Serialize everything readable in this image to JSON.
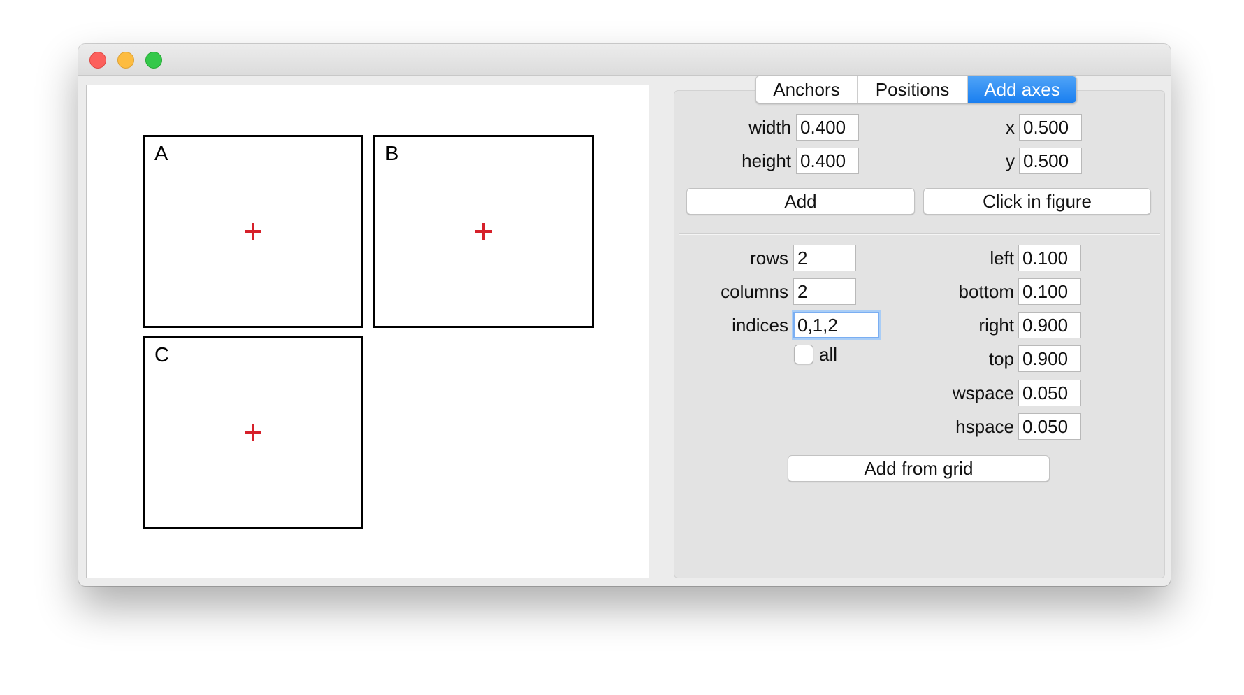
{
  "window": {
    "controls": {
      "close": "close-button",
      "minimize": "minimize-button",
      "zoom": "zoom-button"
    }
  },
  "figure": {
    "axes": [
      {
        "label": "A",
        "marker": "red-cross-icon"
      },
      {
        "label": "B",
        "marker": "red-cross-icon"
      },
      {
        "label": "C",
        "marker": "red-cross-icon"
      }
    ],
    "marker_color": "#d6202a"
  },
  "tabs": [
    {
      "label": "Anchors",
      "active": false
    },
    {
      "label": "Positions",
      "active": false
    },
    {
      "label": "Add axes",
      "active": true
    }
  ],
  "accent_color": "#1a7ff0",
  "add_axes": {
    "width_label": "width",
    "width_value": "0.400",
    "height_label": "height",
    "height_value": "0.400",
    "x_label": "x",
    "x_value": "0.500",
    "y_label": "y",
    "y_value": "0.500",
    "add_button": "Add",
    "click_button": "Click in figure"
  },
  "grid": {
    "rows_label": "rows",
    "rows_value": "2",
    "columns_label": "columns",
    "columns_value": "2",
    "indices_label": "indices",
    "indices_value": "0,1,2",
    "all_label": "all",
    "all_checked": false,
    "left_label": "left",
    "left_value": "0.100",
    "bottom_label": "bottom",
    "bottom_value": "0.100",
    "right_label": "right",
    "right_value": "0.900",
    "top_label": "top",
    "top_value": "0.900",
    "wspace_label": "wspace",
    "wspace_value": "0.050",
    "hspace_label": "hspace",
    "hspace_value": "0.050",
    "add_grid_button": "Add from grid"
  }
}
